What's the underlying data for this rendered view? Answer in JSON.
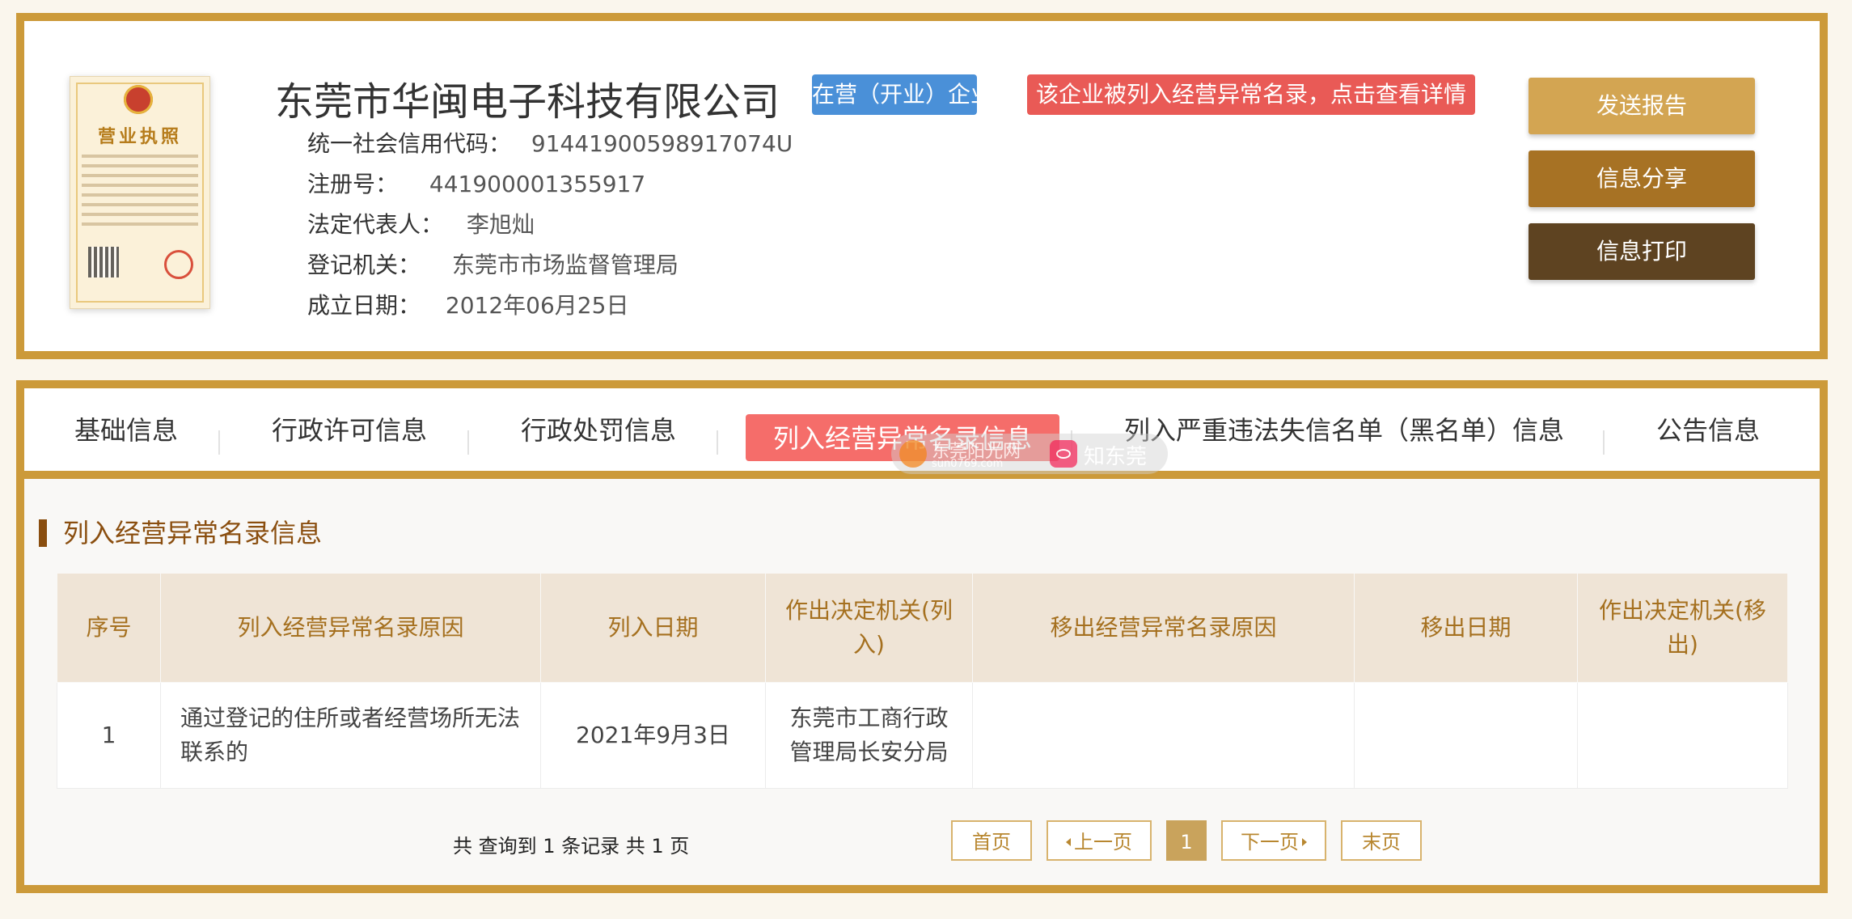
{
  "company": {
    "name": "东莞市华闽电子科技有限公司",
    "status_badge": "在营（开业）企业",
    "abnormal_badge": "该企业被列入经营异常名录，点击查看详情",
    "license": {
      "title": "营业执照"
    },
    "fields": [
      {
        "label": "统一社会信用代码：",
        "value": "91441900598917074U"
      },
      {
        "label": "注册号：",
        "value": "441900001355917"
      },
      {
        "label": "法定代表人：",
        "value": "李旭灿"
      },
      {
        "label": "登记机关：",
        "value": "东莞市市场监督管理局"
      },
      {
        "label": "成立日期：",
        "value": "2012年06月25日"
      }
    ]
  },
  "actions": {
    "send_report": "发送报告",
    "share_info": "信息分享",
    "print_info": "信息打印"
  },
  "tabs": [
    {
      "label": "基础信息",
      "active": false
    },
    {
      "label": "行政许可信息",
      "active": false
    },
    {
      "label": "行政处罚信息",
      "active": false
    },
    {
      "label": "列入经营异常名录信息",
      "active": true
    },
    {
      "label": "列入严重违法失信名单（黑名单）信息",
      "active": false
    },
    {
      "label": "公告信息",
      "active": false
    }
  ],
  "watermark": {
    "site_name": "东莞阳光网",
    "site_url": "sun0769.com",
    "app_name": "知东莞"
  },
  "section": {
    "title": "列入经营异常名录信息"
  },
  "table": {
    "headers": [
      "序号",
      "列入经营异常名录原因",
      "列入日期",
      "作出决定机关(列入)",
      "移出经营异常名录原因",
      "移出日期",
      "作出决定机关(移出)"
    ],
    "rows": [
      [
        "1",
        "通过登记的住所或者经营场所无法联系的",
        "2021年9月3日",
        "东莞市工商行政管理局长安分局",
        "",
        "",
        ""
      ]
    ]
  },
  "pagination": {
    "summary": "共 查询到 1 条记录 共 1 页",
    "first": "首页",
    "prev": "上一页",
    "current": "1",
    "next": "下一页",
    "last": "末页"
  },
  "colors": {
    "frame": "#cc9a3a",
    "status_blue": "#4a90d8",
    "alert_red": "#e95a56",
    "active_tab": "#f56d6a",
    "btn_send": "#d3a552",
    "btn_share": "#a77224",
    "btn_print": "#5e4321",
    "section_title": "#8a4e0f"
  }
}
